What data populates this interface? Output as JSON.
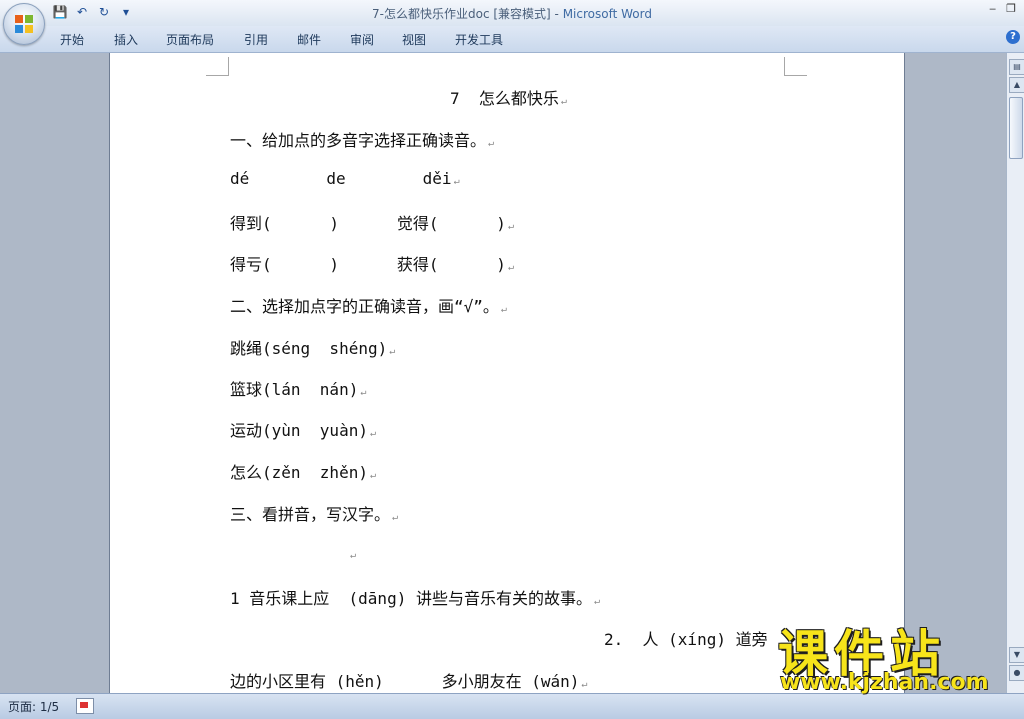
{
  "window": {
    "title_doc": "7-怎么都快乐作业doc [兼容模式] - ",
    "title_app": "Microsoft Word",
    "controls": [
      "‒",
      "❐"
    ]
  },
  "quick_access": [
    {
      "name": "save-icon",
      "glyph": "💾"
    },
    {
      "name": "undo-icon",
      "glyph": "↶"
    },
    {
      "name": "redo-icon",
      "glyph": "↻"
    },
    {
      "name": "customize-icon",
      "glyph": "▾"
    }
  ],
  "ribbon": {
    "tabs": [
      "开始",
      "插入",
      "页面布局",
      "引用",
      "邮件",
      "审阅",
      "视图",
      "开发工具"
    ]
  },
  "document": {
    "title": "7  怎么都快乐",
    "sec1": "一、给加点的多音字选择正确读音。",
    "pinyin_row": "dé        de        děi",
    "q1_row1": "得到(      )      觉得(      )",
    "q1_row2": "得亏(      )      获得(      )",
    "sec2": "二、选择加点字的正确读音，画“√”。",
    "q2_1": "跳绳(séng  shéng)",
    "q2_2": "篮球(lán  nán)",
    "q2_3": "运动(yùn  yuàn)",
    "q2_4": "怎么(zěn  zhěn)",
    "sec3": "三、看拼音，写汉字。",
    "blank": "",
    "s1": "1 音乐课上应  (dāng) 讲些与音乐有关的故事。",
    "s2": "2.  人 (xíng) 道旁",
    "s3": "边的小区里有 (hěn)      多小朋友在 (wán)",
    "paragraph_mark": "↵"
  },
  "status": {
    "page": "页面: 1/5"
  },
  "watermark": {
    "title": "课件站",
    "url": "www.kjzhan.com"
  },
  "colors": {
    "titlebar": "#dbe5f1",
    "app_title": "#3f6ba3",
    "workspace": "#aeb8c7",
    "watermark": "#f7e41a"
  }
}
